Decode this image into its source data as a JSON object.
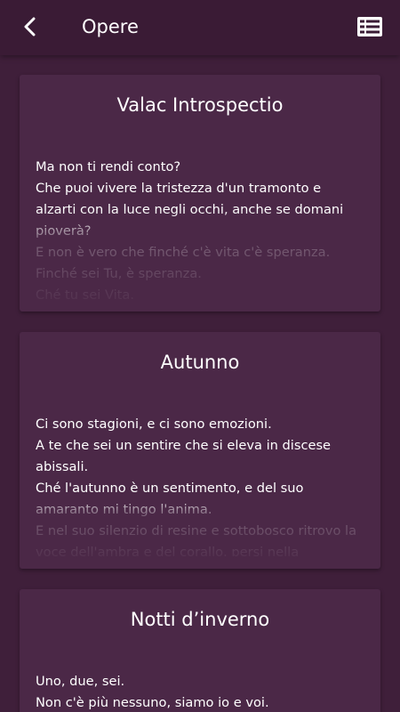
{
  "appbar": {
    "title": "Opere",
    "back_icon": "chevron-left-icon",
    "list_icon": "list-view-icon"
  },
  "colors": {
    "background": "#3f1f3a",
    "appbar": "#3a1b35",
    "card": "#4b2847",
    "text": "#ffffff"
  },
  "cards": [
    {
      "title": "Valac Introspectio",
      "text": "Ma non ti rendi conto?\nChe puoi vivere la tristezza d'un tramonto e alzarti con la luce negli occhi, anche se domani pioverà?\nE non è vero che finché c'è vita c'è speranza.\nFinché sei Tu, è speranza.\nChé tu sei Vita.\nChé sei dominio del tuo mondo."
    },
    {
      "title": "Autunno",
      "text": "Ci sono stagioni, e ci sono emozioni.\nA te che sei un sentire che si eleva in discese abissali.\nChé l'autunno è un sentimento, e del suo amaranto mi tingo l'anima.\nE nel suo silenzio di resine e sottobosco ritrovo la voce dell'ambra e del corallo, persi nella persistenza di un calore che avvolge e ammanta"
    },
    {
      "title": "Notti d’inverno",
      "text": "Uno, due, sei.\nNon c'è più nessuno, siamo io e voi.\nTre, quattro, nove."
    }
  ]
}
